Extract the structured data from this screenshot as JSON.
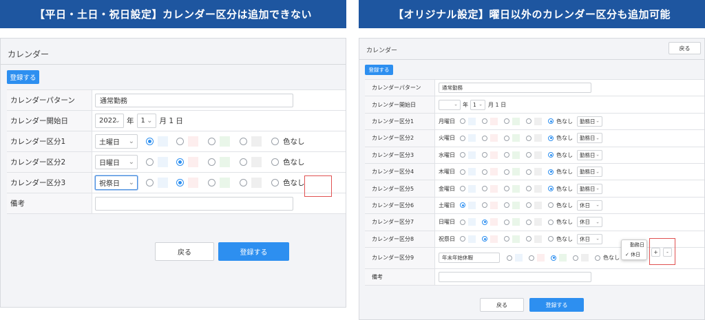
{
  "banners": {
    "left": "【平日・土日・祝日設定】カレンダー区分は追加できない",
    "right": "【オリジナル設定】曜日以外のカレンダー区分も追加可能"
  },
  "left": {
    "title": "カレンダー",
    "register_top": "登録する",
    "pattern_label": "カレンダーパターン",
    "pattern_value": "通常勤務",
    "start_label": "カレンダー開始日",
    "start_year": "2022",
    "year_unit": "年",
    "start_month": "1",
    "month_day_text": "月 1 日",
    "no_color": "色なし",
    "categories": [
      {
        "label": "カレンダー区分1",
        "select": "土曜日",
        "selected": 0
      },
      {
        "label": "カレンダー区分2",
        "select": "日曜日",
        "selected": 1
      },
      {
        "label": "カレンダー区分3",
        "select": "祝祭日",
        "selected": 1
      }
    ],
    "note_label": "備考",
    "back": "戻る",
    "register_bottom": "登録する"
  },
  "right": {
    "title": "カレンダー",
    "back_top": "戻る",
    "register_top": "登録する",
    "pattern_label": "カレンダーパターン",
    "pattern_value": "通常勤務",
    "start_label": "カレンダー開始日",
    "year_unit": "年",
    "start_month": "1",
    "month_day_text": "月 1 日",
    "no_color": "色なし",
    "categories": [
      {
        "label": "カレンダー区分1",
        "day": "月曜日",
        "selected": 4,
        "type": "勤務日"
      },
      {
        "label": "カレンダー区分2",
        "day": "火曜日",
        "selected": 4,
        "type": "勤務日"
      },
      {
        "label": "カレンダー区分3",
        "day": "水曜日",
        "selected": 4,
        "type": "勤務日"
      },
      {
        "label": "カレンダー区分4",
        "day": "木曜日",
        "selected": 4,
        "type": "勤務日"
      },
      {
        "label": "カレンダー区分5",
        "day": "金曜日",
        "selected": 4,
        "type": "勤務日"
      },
      {
        "label": "カレンダー区分6",
        "day": "土曜日",
        "selected": 0,
        "type": "休日"
      },
      {
        "label": "カレンダー区分7",
        "day": "日曜日",
        "selected": 1,
        "type": "休日"
      },
      {
        "label": "カレンダー区分8",
        "day": "祝祭日",
        "selected": 1,
        "type": "休日"
      }
    ],
    "cat9": {
      "label": "カレンダー区分9",
      "value": "年末年始休暇",
      "selected": 2
    },
    "dropdown_options": [
      "勤務日",
      "休日"
    ],
    "dropdown_checked": "✓",
    "plus": "+",
    "minus": "-",
    "note_label": "備考",
    "back": "戻る",
    "register_bottom": "登録する"
  },
  "colors": {
    "banner": "#1e56a0",
    "primary": "#2d8ff0",
    "swatches": [
      "#ecf4fc",
      "#fdeeee",
      "#e9f6e9",
      "#efefef"
    ],
    "highlight": "#e05050"
  }
}
